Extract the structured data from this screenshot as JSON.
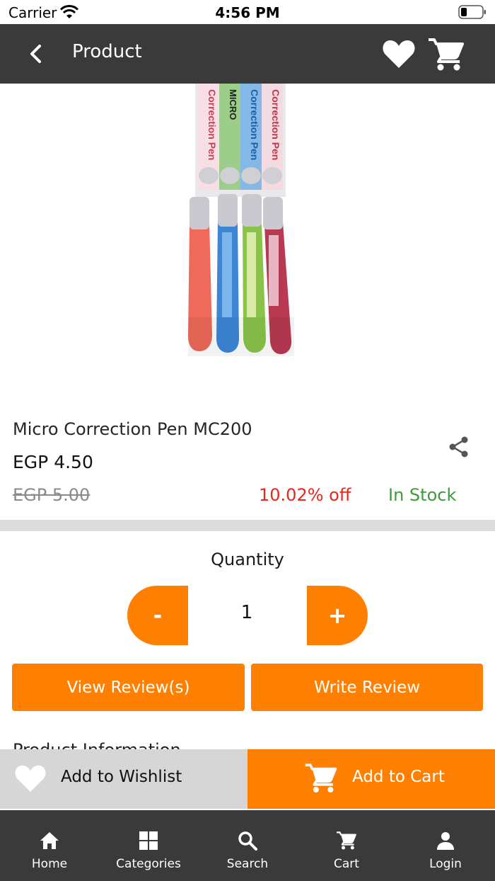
{
  "status_bar": {
    "carrier": "Carrier",
    "time": "4:56 PM"
  },
  "header": {
    "title": "Product",
    "icons": [
      "back-icon",
      "heart-icon",
      "cart-icon"
    ]
  },
  "product": {
    "image_alt": "Micro Correction Pen MC200 pack of four pens",
    "image_text": [
      "Correction Pen",
      "MICRO",
      "Correction Pen",
      "Correction Pen"
    ],
    "name": "Micro Correction Pen MC200",
    "price": "EGP 4.50",
    "old_price": "EGP 5.00",
    "discount": "10.02% off",
    "stock": "In Stock"
  },
  "quantity": {
    "label": "Quantity",
    "minus": "-",
    "value": "1",
    "plus": "+"
  },
  "reviews": {
    "view_label": "View Review(s)",
    "write_label": "Write Review"
  },
  "peek_text": "Product Information",
  "action_bar": {
    "wishlist_label": "Add to Wishlist",
    "cart_label": "Add to Cart"
  },
  "tabs": [
    {
      "label": "Home",
      "icon": "home-icon"
    },
    {
      "label": "Categories",
      "icon": "grid-icon"
    },
    {
      "label": "Search",
      "icon": "search-icon"
    },
    {
      "label": "Cart",
      "icon": "cart-icon"
    },
    {
      "label": "Login",
      "icon": "user-icon"
    }
  ],
  "colors": {
    "accent": "#ff8000",
    "header_bg": "#3a3a3a",
    "discount": "#e8261c",
    "stock": "#3d9a3d"
  }
}
